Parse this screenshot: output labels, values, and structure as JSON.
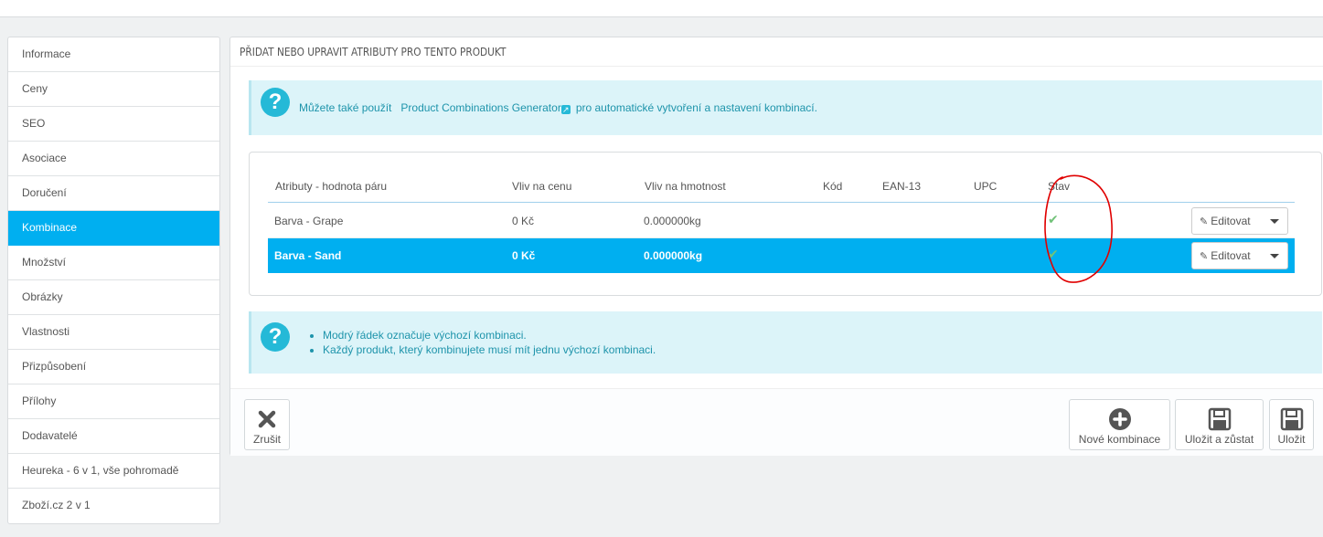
{
  "sidebar": {
    "items": [
      {
        "label": "Informace",
        "active": false
      },
      {
        "label": "Ceny",
        "active": false
      },
      {
        "label": "SEO",
        "active": false
      },
      {
        "label": "Asociace",
        "active": false
      },
      {
        "label": "Doručení",
        "active": false
      },
      {
        "label": "Kombinace",
        "active": true
      },
      {
        "label": "Množství",
        "active": false
      },
      {
        "label": "Obrázky",
        "active": false
      },
      {
        "label": "Vlastnosti",
        "active": false
      },
      {
        "label": "Přizpůsobení",
        "active": false
      },
      {
        "label": "Přílohy",
        "active": false
      },
      {
        "label": "Dodavatelé",
        "active": false
      },
      {
        "label": "Heureka - 6 v 1, vše pohromadě",
        "active": false
      },
      {
        "label": "Zboží.cz 2 v 1",
        "active": false
      }
    ]
  },
  "panel": {
    "heading": "PŘIDAT NEBO UPRAVIT ATRIBUTY PRO TENTO PRODUKT",
    "info_top": {
      "before": "Můžete také použít",
      "link": "Product Combinations Generator",
      "after": "pro automatické vytvoření a nastavení kombinací."
    },
    "table": {
      "headers": {
        "attributes": "Atributy - hodnota páru",
        "price": "Vliv na cenu",
        "weight": "Vliv na hmotnost",
        "code": "Kód",
        "ean": "EAN-13",
        "upc": "UPC",
        "status": "Stav"
      },
      "rows": [
        {
          "attributes": "Barva - Grape",
          "price": "0 Kč",
          "weight": "0.000000kg",
          "code": "",
          "ean": "",
          "upc": "",
          "status": "enabled",
          "default": false,
          "edit_label": "Editovat"
        },
        {
          "attributes": "Barva - Sand",
          "price": "0 Kč",
          "weight": "0.000000kg",
          "code": "",
          "ean": "",
          "upc": "",
          "status": "enabled",
          "default": true,
          "edit_label": "Editovat"
        }
      ]
    },
    "info_bottom": {
      "items": [
        "Modrý řádek označuje výchozí kombinaci.",
        "Každý produkt, který kombinujete musí mít jednu výchozí kombinaci."
      ]
    },
    "footer": {
      "cancel": "Zrušit",
      "new_combination": "Nové kombinace",
      "save_stay": "Uložit a zůstat",
      "save": "Uložit"
    }
  },
  "colors": {
    "accent": "#00aff0",
    "info_bg": "#dcf4f9",
    "info_text": "#1e94ab",
    "check": "#72c279",
    "annotation": "#e00000"
  },
  "icons": {
    "help": "question-circle-icon",
    "external": "external-link-icon",
    "check": "check-icon",
    "edit": "pencil-icon",
    "caret": "caret-down-icon",
    "cancel": "close-icon",
    "new": "plus-circle-icon",
    "save": "floppy-disk-icon"
  }
}
